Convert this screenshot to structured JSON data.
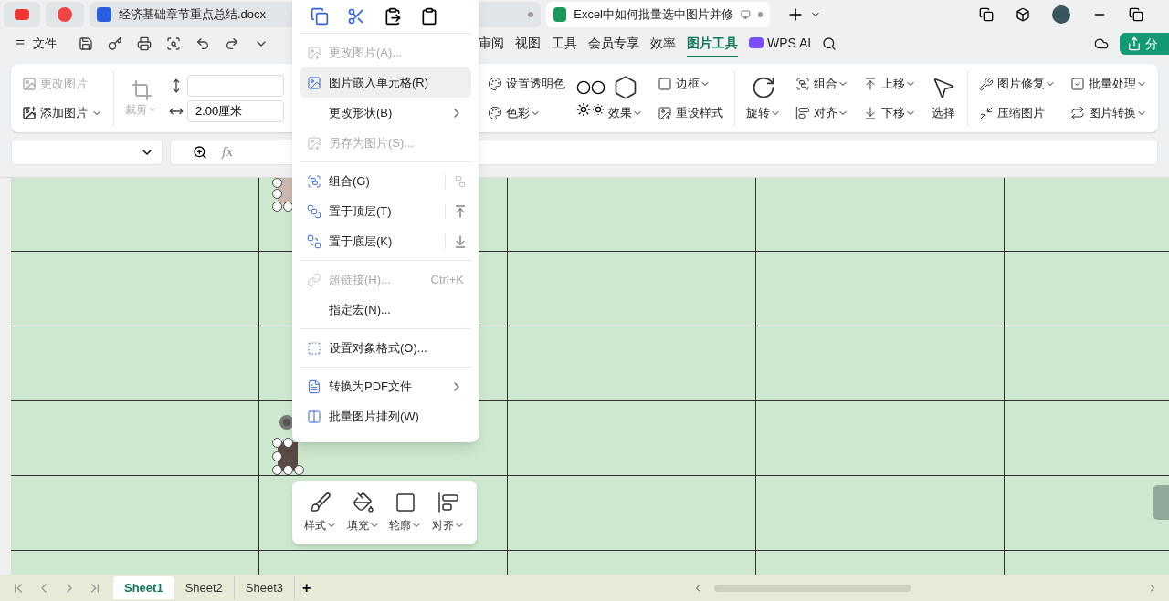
{
  "title_bar": {
    "tabs": [
      {
        "label": "经济基础章节重点总结.docx",
        "selected": false
      },
      {
        "label": "Excel中如何批量选中图片并修",
        "selected": true
      }
    ]
  },
  "menu_bar": {
    "file": "文件",
    "tabs": [
      {
        "label": "审阅",
        "selected": false
      },
      {
        "label": "视图",
        "selected": false
      },
      {
        "label": "工具",
        "selected": false
      },
      {
        "label": "会员专享",
        "selected": false
      },
      {
        "label": "效率",
        "selected": false
      },
      {
        "label": "图片工具",
        "selected": true
      },
      {
        "label": "WPS AI",
        "selected": false
      }
    ],
    "share": "分"
  },
  "ribbon": {
    "change_picture": {
      "label": "更改图片",
      "disabled": true
    },
    "add_picture": {
      "label": "添加图片",
      "disabled": false
    },
    "crop": {
      "label": "裁剪",
      "disabled": true
    },
    "width_field": {
      "value": "2.00厘米"
    },
    "groups": [
      [
        {
          "kind": "stack",
          "buttons": [
            {
              "label": "设置透明色",
              "dropdown": false
            },
            {
              "label": "色彩",
              "dropdown": true
            }
          ]
        },
        {
          "kind": "icons"
        },
        {
          "kind": "large",
          "buttons": [
            {
              "label": "效果",
              "dropdown": true
            }
          ]
        },
        {
          "kind": "stack",
          "buttons": [
            {
              "label": "边框",
              "dropdown": true
            },
            {
              "label": "重设样式",
              "dropdown": false
            }
          ]
        }
      ],
      [
        {
          "kind": "large",
          "buttons": [
            {
              "label": "旋转",
              "dropdown": true
            }
          ]
        },
        {
          "kind": "stack",
          "buttons": [
            {
              "label": "组合",
              "dropdown": true
            },
            {
              "label": "对齐",
              "dropdown": true
            }
          ]
        },
        {
          "kind": "stack",
          "buttons": [
            {
              "label": "上移",
              "dropdown": true
            },
            {
              "label": "下移",
              "dropdown": true
            }
          ]
        },
        {
          "kind": "large",
          "buttons": [
            {
              "label": "选择",
              "dropdown": false
            }
          ]
        }
      ],
      [
        {
          "kind": "stack",
          "buttons": [
            {
              "label": "图片修复",
              "dropdown": true
            },
            {
              "label": "压缩图片",
              "dropdown": false
            }
          ]
        },
        {
          "kind": "stack",
          "buttons": [
            {
              "label": "批量处理",
              "dropdown": true
            },
            {
              "label": "图片转换",
              "dropdown": true
            }
          ]
        }
      ]
    ]
  },
  "formula_bar": {
    "fx": "fx"
  },
  "context_menu": {
    "sections": [
      [
        {
          "label": "更改图片(A)...",
          "disabled": true,
          "highlighted": false,
          "submenu": false
        },
        {
          "label": "图片嵌入单元格(R)",
          "disabled": false,
          "highlighted": true,
          "submenu": false
        },
        {
          "label": "更改形状(B)",
          "disabled": false,
          "highlighted": false,
          "submenu": true
        },
        {
          "label": "另存为图片(S)...",
          "disabled": true,
          "highlighted": false,
          "submenu": false
        }
      ],
      [
        {
          "label": "组合(G)",
          "disabled": false,
          "highlighted": false,
          "submenu": false
        },
        {
          "label": "置于顶层(T)",
          "disabled": false,
          "highlighted": false,
          "submenu": false
        },
        {
          "label": "置于底层(K)",
          "disabled": false,
          "highlighted": false,
          "submenu": false
        }
      ],
      [
        {
          "label": "超链接(H)...",
          "disabled": true,
          "highlighted": false,
          "submenu": false,
          "shortcut": "Ctrl+K"
        },
        {
          "label": "指定宏(N)...",
          "disabled": false,
          "highlighted": false,
          "submenu": false
        }
      ],
      [
        {
          "label": "设置对象格式(O)...",
          "disabled": false,
          "highlighted": false,
          "submenu": false
        }
      ],
      [
        {
          "label": "转换为PDF文件",
          "disabled": false,
          "highlighted": false,
          "submenu": true
        },
        {
          "label": "批量图片排列(W)",
          "disabled": false,
          "highlighted": false,
          "submenu": false
        }
      ]
    ]
  },
  "float_toolbar": [
    {
      "label": "样式"
    },
    {
      "label": "填充"
    },
    {
      "label": "轮廓"
    },
    {
      "label": "对齐"
    }
  ],
  "sheet_tabs": [
    {
      "label": "Sheet1",
      "selected": true
    },
    {
      "label": "Sheet2",
      "selected": false
    },
    {
      "label": "Sheet3",
      "selected": false
    }
  ],
  "add_sheet": "+"
}
